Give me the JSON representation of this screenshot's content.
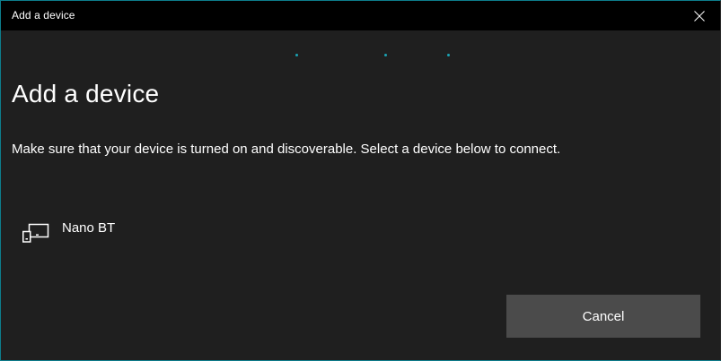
{
  "window": {
    "title": "Add a device",
    "close_icon": "close-icon"
  },
  "progress": {
    "type": "indeterminate",
    "dot_color": "#1aa3b3"
  },
  "main": {
    "heading": "Add a device",
    "instructions": "Make sure that your device is turned on and discoverable. Select a device below to connect."
  },
  "devices": [
    {
      "icon": "device-icon",
      "name": "Nano BT"
    }
  ],
  "footer": {
    "cancel_label": "Cancel"
  },
  "colors": {
    "background": "#1f1f1f",
    "titlebar": "#000000",
    "button": "#4b4b4b",
    "accent": "#1aa3b3",
    "text": "#ffffff"
  }
}
